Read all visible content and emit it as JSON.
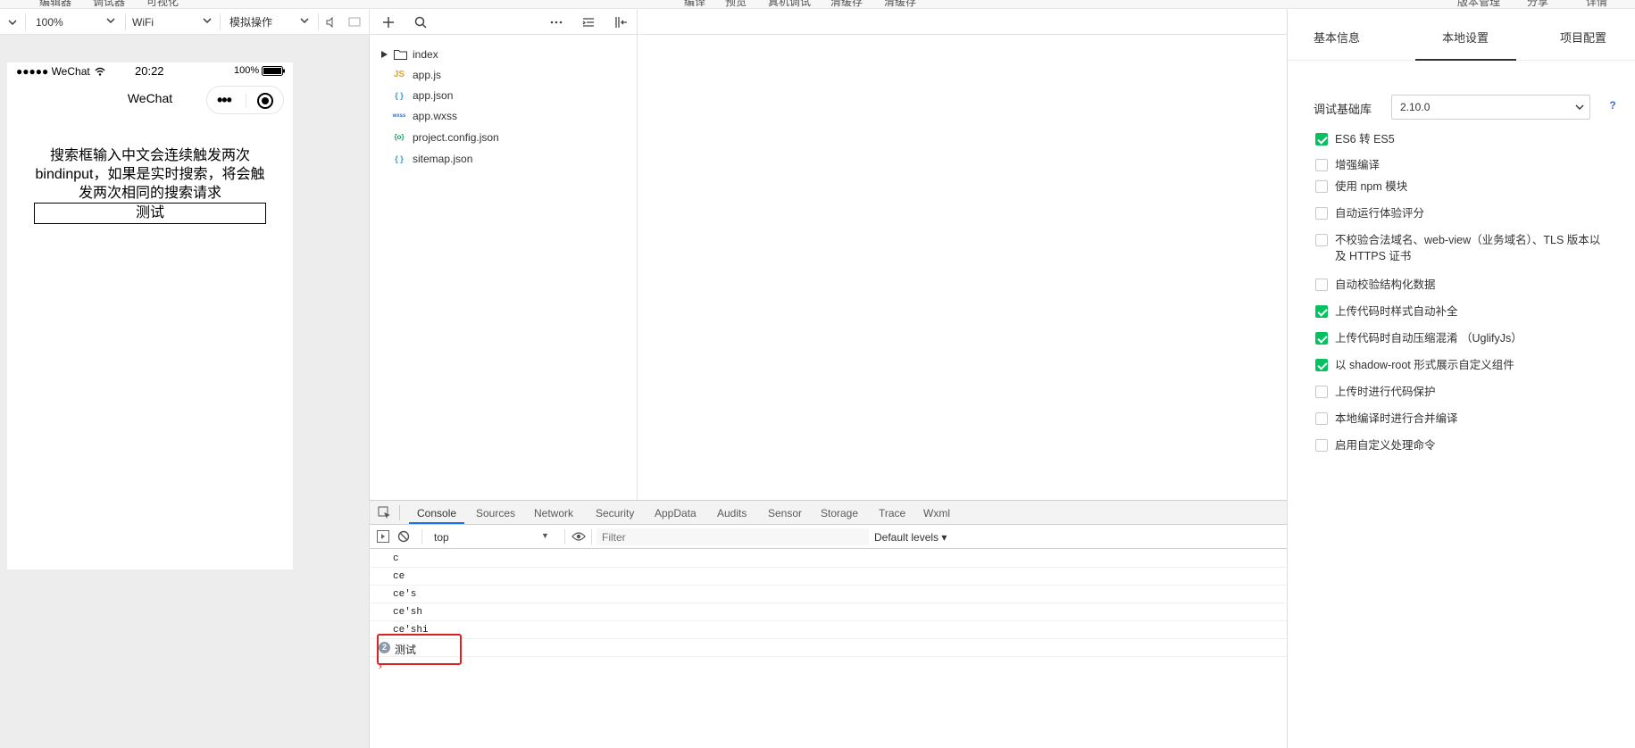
{
  "menu": [
    "编辑器",
    "调试器",
    "可视化",
    "编译",
    "预览",
    "真机调试",
    "清缓存",
    "清缓存",
    "版本管理",
    "分享",
    "详情"
  ],
  "simulator_toolbar": {
    "zoom": "100%",
    "network": "WiFi",
    "operation": "模拟操作"
  },
  "phone": {
    "status": {
      "carrier": "●●●●● WeChat",
      "time": "20:22",
      "battery": "100%"
    },
    "nav_title": "WeChat",
    "text": "搜索框输入中文会连续触发两次bindinput，如果是实时搜索，将会触发两次相同的搜索请求",
    "button_label": "测试"
  },
  "files": [
    {
      "name": "index",
      "type": "folder"
    },
    {
      "name": "app.js",
      "type": "js",
      "icon": "JS"
    },
    {
      "name": "app.json",
      "type": "json",
      "icon": "{ }"
    },
    {
      "name": "app.wxss",
      "type": "wxss",
      "icon": "wxss"
    },
    {
      "name": "project.config.json",
      "type": "config",
      "icon": "{o}"
    },
    {
      "name": "sitemap.json",
      "type": "json",
      "icon": "{ }"
    }
  ],
  "devtools": {
    "tabs": [
      "Console",
      "Sources",
      "Network",
      "Security",
      "AppData",
      "Audits",
      "Sensor",
      "Storage",
      "Trace",
      "Wxml"
    ],
    "active_tab": "Console",
    "context": "top",
    "filter_placeholder": "Filter",
    "levels": "Default levels ▾",
    "lines": [
      "c",
      "ce",
      "ce's",
      "ce'sh",
      "ce'shi"
    ],
    "grouped": {
      "count": "2",
      "text": "测试"
    },
    "prompt": "›"
  },
  "settings": {
    "tabs": [
      "基本信息",
      "本地设置",
      "项目配置"
    ],
    "active_tab": "本地设置",
    "lib_label": "调试基础库",
    "lib_value": "2.10.0",
    "help": "?",
    "options": [
      {
        "label": "ES6 转 ES5",
        "checked": true
      },
      {
        "label": "增强编译",
        "checked": false
      },
      {
        "label": "使用 npm 模块",
        "checked": false
      },
      {
        "label": "自动运行体验评分",
        "checked": false
      },
      {
        "label": "不校验合法域名、web-view（业务域名）、TLS 版本以及 HTTPS 证书",
        "checked": false
      },
      {
        "label": "自动校验结构化数据",
        "checked": false
      },
      {
        "label": "上传代码时样式自动补全",
        "checked": true
      },
      {
        "label": "上传代码时自动压缩混淆 （UglifyJs）",
        "checked": true
      },
      {
        "label": "以 shadow-root 形式展示自定义组件",
        "checked": true
      },
      {
        "label": "上传时进行代码保护",
        "checked": false
      },
      {
        "label": "本地编译时进行合并编译",
        "checked": false
      },
      {
        "label": "启用自定义处理命令",
        "checked": false
      }
    ]
  },
  "colors": {
    "accent_green": "#07c160",
    "tab_blue": "#1a73e8",
    "highlight_red": "#e02020"
  }
}
